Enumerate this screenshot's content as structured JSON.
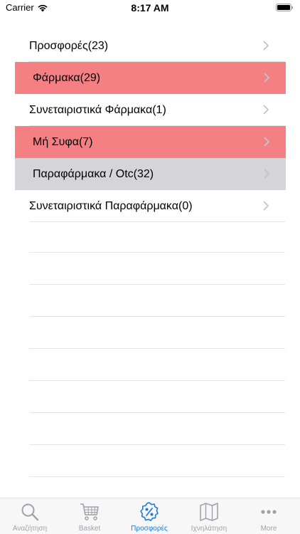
{
  "status": {
    "carrier": "Carrier",
    "time": "8:17 AM"
  },
  "categories": [
    {
      "label": "Προσφορές(23)",
      "highlight": "none"
    },
    {
      "label": "Φάρμακα(29)",
      "highlight": "red"
    },
    {
      "label": "Συνεταιριστικά Φάρμακα(1)",
      "highlight": "none"
    },
    {
      "label": "Μή Συφα(7)",
      "highlight": "red"
    },
    {
      "label": "Παραφάρμακα / Otc(32)",
      "highlight": "gray"
    },
    {
      "label": "Συνεταιριστικά Παραφάρμακα(0)",
      "highlight": "none"
    }
  ],
  "colors": {
    "highlight_red": "#f58084",
    "highlight_gray": "#d5d5d9",
    "tab_active": "#1e7ad6",
    "tab_inactive": "#a2a2a6"
  },
  "tabbar": {
    "items": [
      {
        "label": "Αναζήτηση",
        "icon": "search-icon",
        "active": false
      },
      {
        "label": "Basket",
        "icon": "cart-icon",
        "active": false
      },
      {
        "label": "Προσφορές",
        "icon": "percent-badge-icon",
        "active": true
      },
      {
        "label": "Ιχνηλάτηση",
        "icon": "map-icon",
        "active": false
      },
      {
        "label": "More",
        "icon": "more-dots-icon",
        "active": false
      }
    ]
  }
}
